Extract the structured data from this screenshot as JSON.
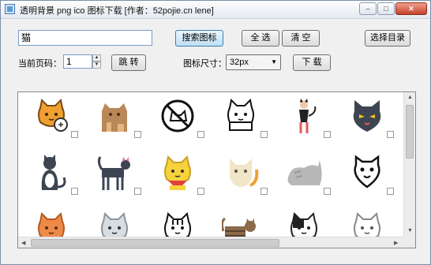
{
  "window": {
    "title": "透明背景 png ico 图标下载 [作者：52pojie.cn lene]",
    "min_glyph": "–",
    "max_glyph": "□",
    "close_glyph": "✕"
  },
  "search": {
    "value": "猫"
  },
  "buttons": {
    "search": "搜索图标",
    "select_all": "全 选",
    "clear": "清 空",
    "choose_dir": "选择目录",
    "jump": "跳 转",
    "download": "下 载"
  },
  "page": {
    "label": "当前页码：",
    "value": "1"
  },
  "icon_size": {
    "label": "图标尺寸：",
    "selected": "32px"
  },
  "icons": [
    "sleepy-orange-cat-icon",
    "brown-cat-family-icon",
    "no-cats-sign-icon",
    "cat-outline-icon",
    "cat-woman-icon",
    "dark-angry-cat-icon",
    "sitting-black-white-cat-icon",
    "standing-black-cat-icon",
    "yellow-cat-red-bandana-icon",
    "cream-cat-with-tail-icon",
    "gray-cat-stretching-icon",
    "cat-face-outline-icon",
    "orange-cat-face-icon",
    "gray-white-cat-face-icon",
    "tabby-cat-outline-icon",
    "brown-tabby-cat-icon",
    "black-white-cat-icon",
    "white-cat-face-icon"
  ],
  "colors": {
    "orange": "#f0a030",
    "brown": "#b98858",
    "dark": "#3d4552",
    "yellow": "#f7d23c",
    "red": "#e0403a",
    "gray": "#b8b8b8"
  }
}
